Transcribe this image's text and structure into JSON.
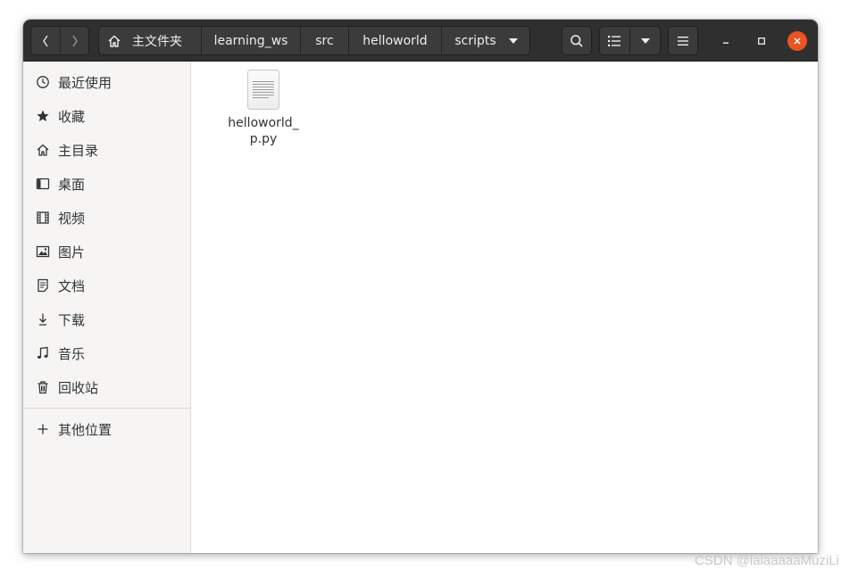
{
  "window": {
    "nav": {
      "back_icon": "chevron-left-icon",
      "forward_icon": "chevron-right-icon"
    },
    "breadcrumb": {
      "home_icon": "home-icon",
      "home_label": "主文件夹",
      "items": [
        "learning_ws",
        "src",
        "helloworld",
        "scripts"
      ],
      "dropdown_icon": "caret-down-icon"
    },
    "toolbar": {
      "search_icon": "search-icon",
      "view_icon": "list-view-icon",
      "view_menu_icon": "caret-down-icon",
      "menu_icon": "hamburger-menu-icon"
    },
    "controls": {
      "minimize_icon": "minimize-icon",
      "maximize_icon": "maximize-icon",
      "close_icon": "close-icon",
      "close_color": "#e95420"
    }
  },
  "sidebar": {
    "places": [
      {
        "label": "最近使用",
        "icon": "clock-icon"
      },
      {
        "label": "收藏",
        "icon": "star-icon"
      },
      {
        "label": "主目录",
        "icon": "home-icon"
      },
      {
        "label": "桌面",
        "icon": "desktop-icon"
      },
      {
        "label": "视频",
        "icon": "video-icon"
      },
      {
        "label": "图片",
        "icon": "image-icon"
      },
      {
        "label": "文档",
        "icon": "document-icon"
      },
      {
        "label": "下载",
        "icon": "download-icon"
      },
      {
        "label": "音乐",
        "icon": "music-icon"
      },
      {
        "label": "回收站",
        "icon": "trash-icon"
      }
    ],
    "other": {
      "label": "其他位置",
      "icon": "plus-icon"
    }
  },
  "content": {
    "files": [
      {
        "name": "helloworld_p.py",
        "icon": "text-file-icon"
      }
    ]
  },
  "colors": {
    "header_bg": "#2f2f2f",
    "sidebar_bg": "#f6f5f4",
    "accent": "#e95420"
  },
  "watermark": "CSDN @lalaaaaaMuziLi"
}
